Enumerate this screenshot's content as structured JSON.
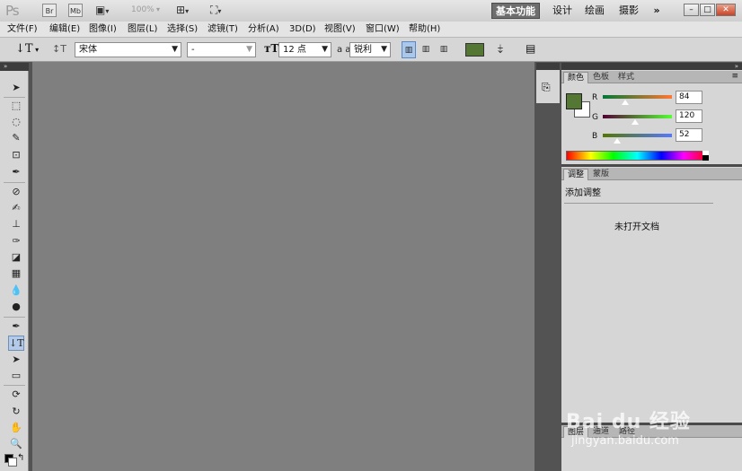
{
  "appbar": {
    "logo": "Ps",
    "br_label": "Br",
    "mb_label": "Mb",
    "zoom": "100%",
    "workspaces": [
      "基本功能",
      "设计",
      "绘画",
      "摄影"
    ],
    "more": "»"
  },
  "menubar": {
    "items": [
      "文件(F)",
      "编辑(E)",
      "图像(I)",
      "图层(L)",
      "选择(S)",
      "滤镜(T)",
      "分析(A)",
      "3D(D)",
      "视图(V)",
      "窗口(W)",
      "帮助(H)"
    ]
  },
  "options": {
    "font_family": "宋体",
    "font_style": "-",
    "font_size": "12 点",
    "aa_label": "a a",
    "antialias": "锐利",
    "text_color": "#547834"
  },
  "color_panel": {
    "tabs": [
      "颜色",
      "色板",
      "样式"
    ],
    "r_label": "R",
    "g_label": "G",
    "b_label": "B",
    "r": "84",
    "g": "120",
    "b": "52",
    "fg_color": "#547834",
    "bg_color": "#ffffff"
  },
  "adjust_panel": {
    "tabs": [
      "调整",
      "蒙版"
    ],
    "title": "添加调整",
    "empty_msg": "未打开文档"
  },
  "bottom_panel": {
    "tabs": [
      "图层",
      "通道",
      "路径"
    ]
  },
  "watermark": {
    "brand": "Bai du 经验",
    "url": "jingyan.baidu.com"
  }
}
